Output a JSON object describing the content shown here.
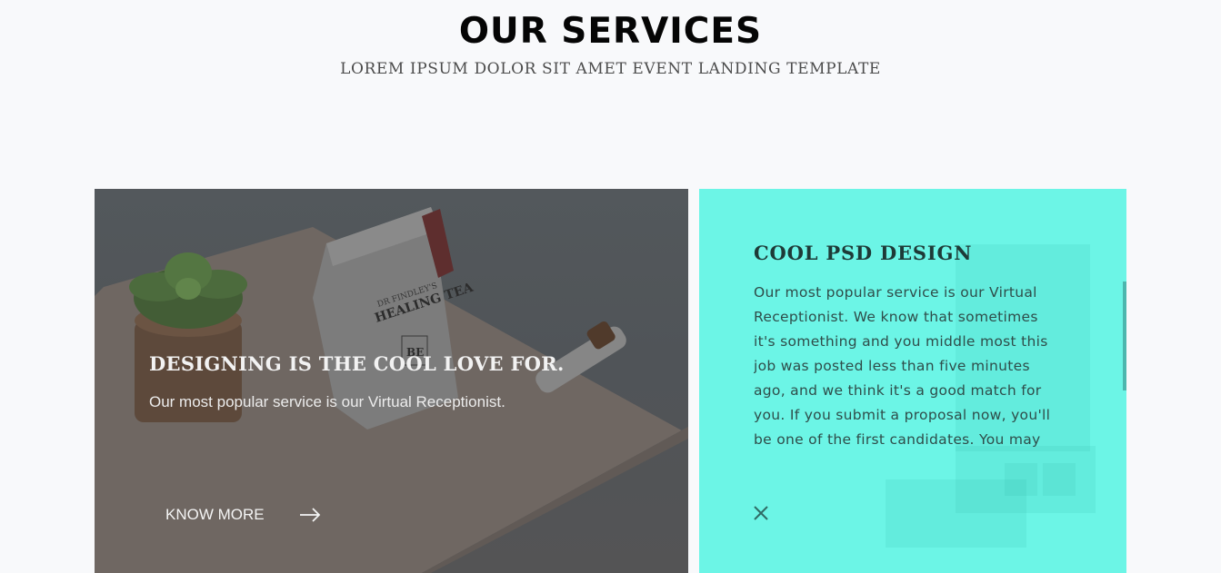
{
  "header": {
    "title": "OUR SERVICES",
    "subtitle": "LOREM IPSUM DOLOR SIT AMET EVENT LANDING TEMPLATE"
  },
  "card_image": {
    "title": "DESIGNING IS THE COOL LOVE FOR.",
    "description": "Our most popular service is our Virtual Receptionist.",
    "button_label": "KNOW MORE",
    "product_text": {
      "brand": "DR FINDLEY'S",
      "name": "HEALING TEA",
      "logo_letters": "BE"
    }
  },
  "card_teal": {
    "title": "COOL PSD DESIGN",
    "text": "Our most popular service is our Virtual Receptionist. We know that sometimes it's something and you middle most this job was posted less than five minutes ago, and we think it's a good match for you. If you submit a proposal now, you'll be one of the first candidates. You may",
    "close_icon": "close-icon"
  },
  "colors": {
    "teal_card": "#6cf5e6",
    "page_background": "#f8f9fb"
  }
}
